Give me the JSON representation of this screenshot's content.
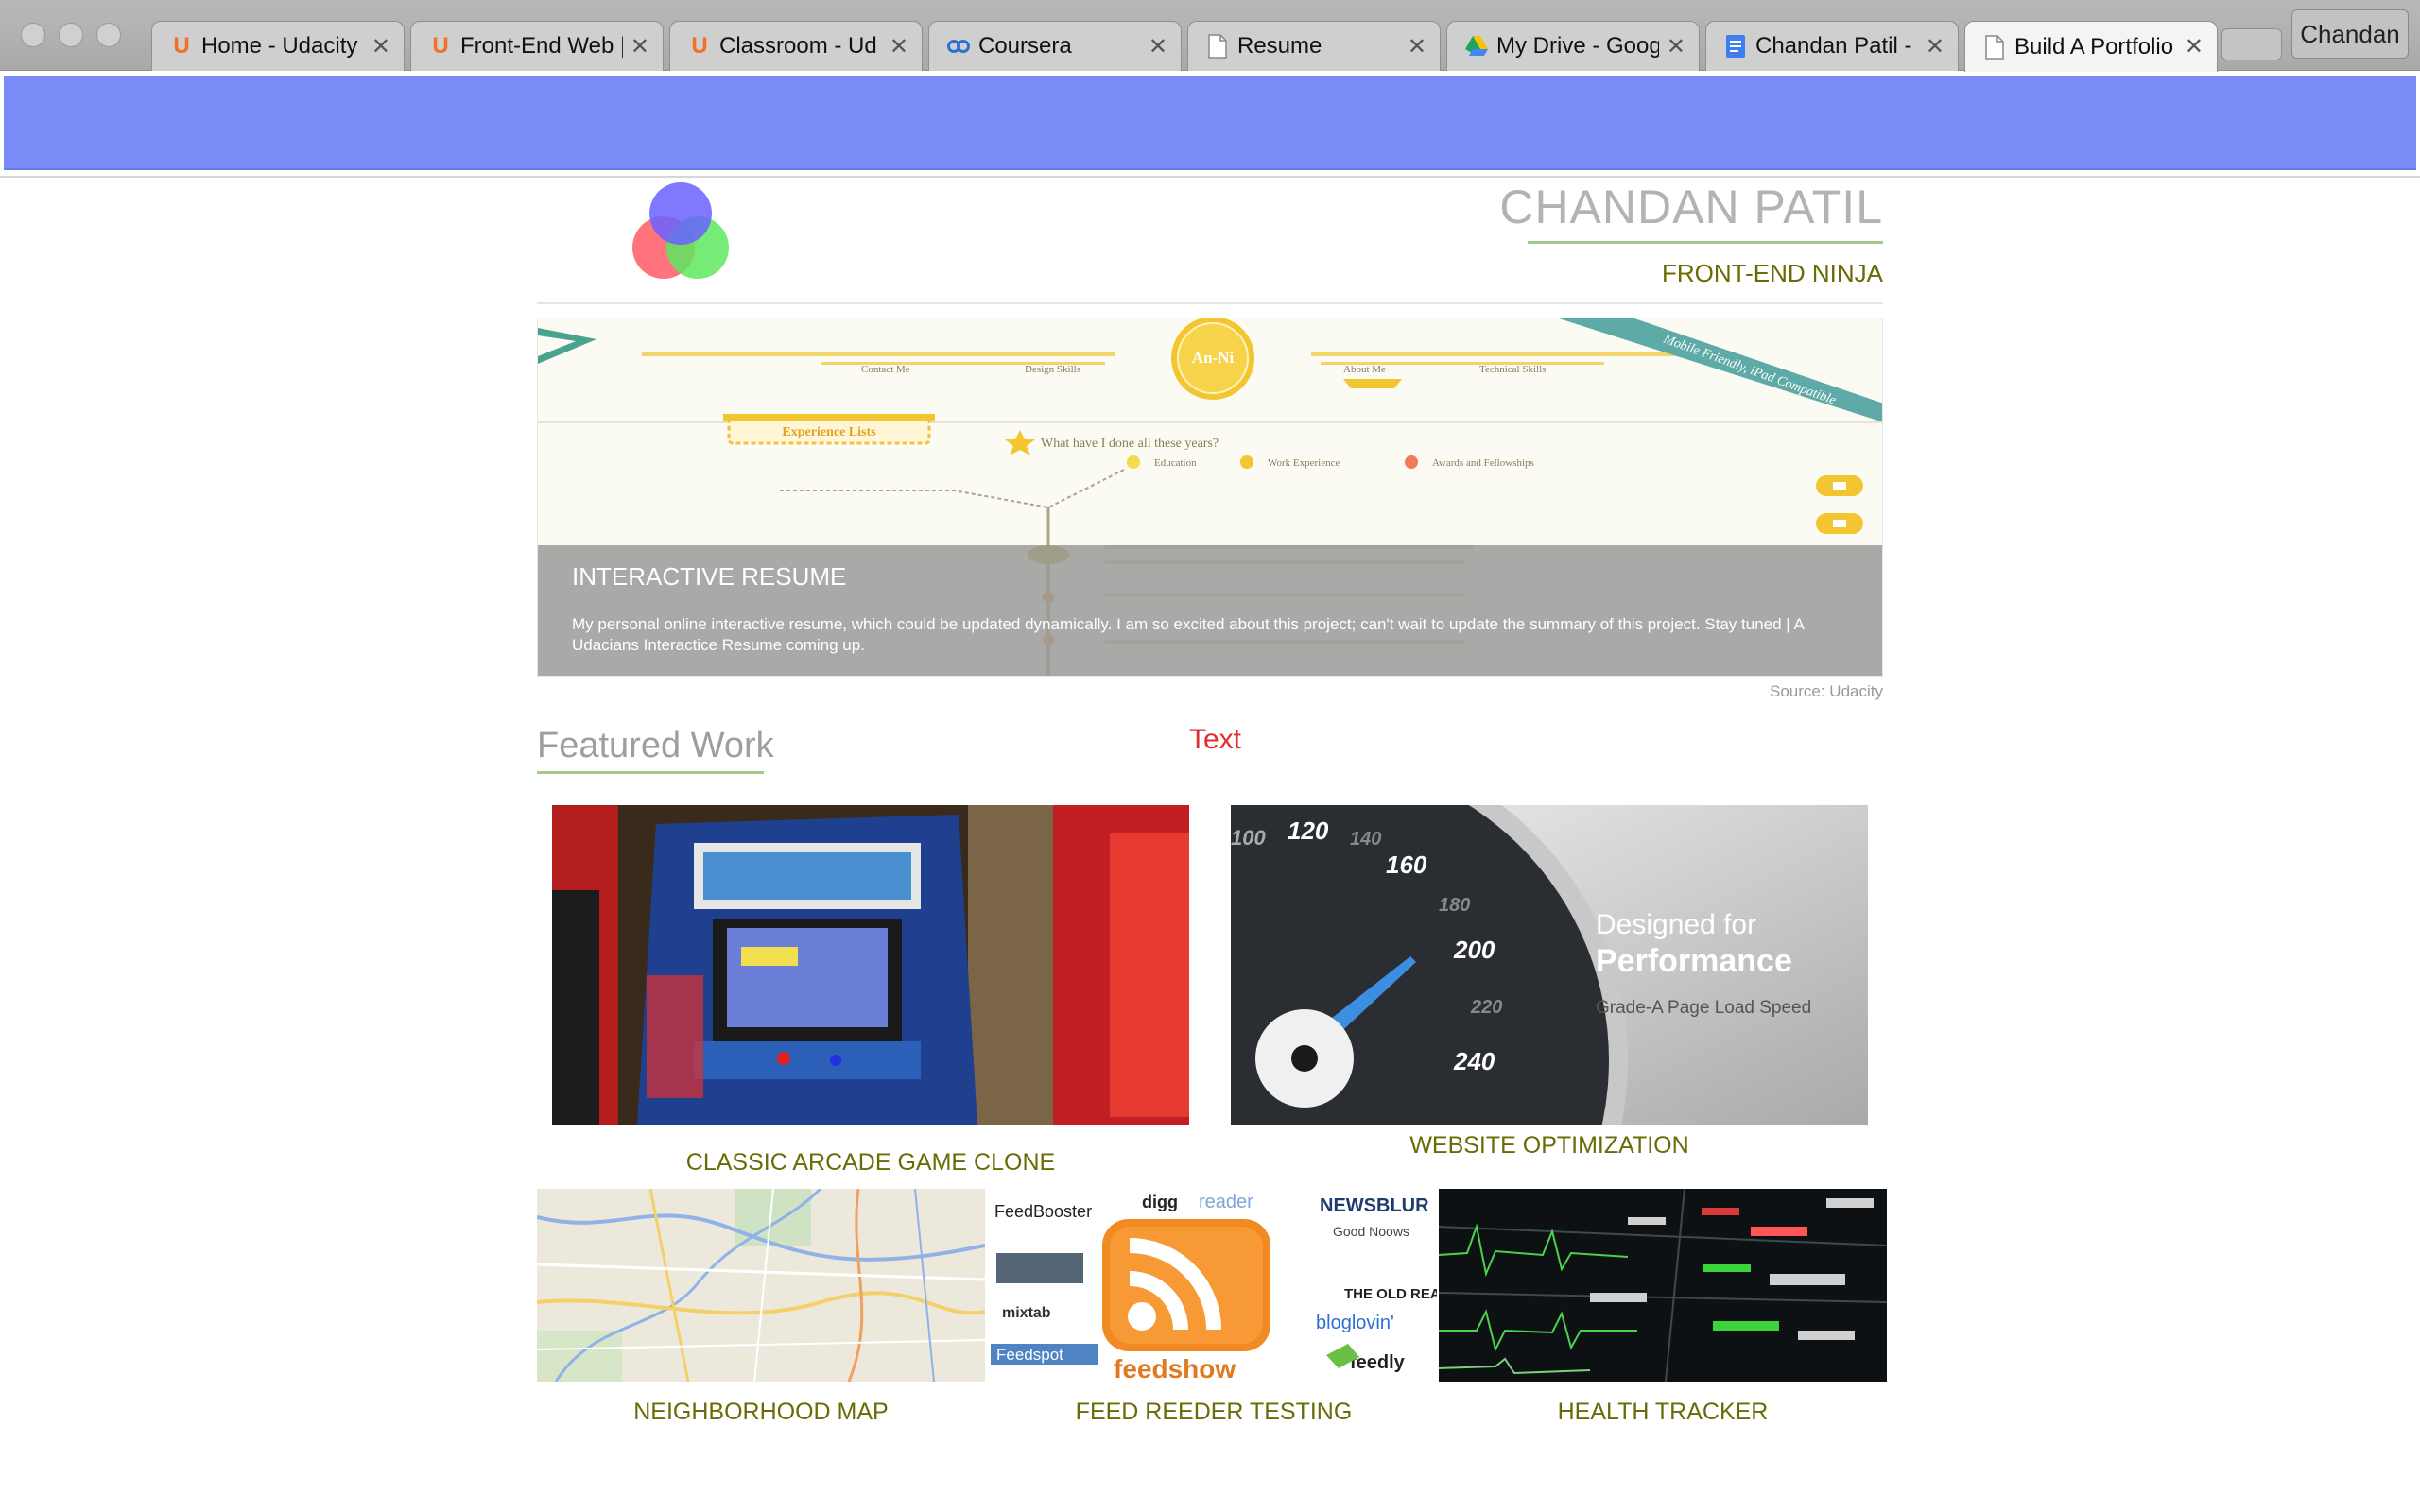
{
  "browser": {
    "tabs": [
      {
        "label": "Home - Udacity",
        "icon": "udacity-icon"
      },
      {
        "label": "Front-End Web |",
        "icon": "udacity-icon"
      },
      {
        "label": "Classroom - Ud",
        "icon": "udacity-icon"
      },
      {
        "label": "Coursera",
        "icon": "coursera-icon"
      },
      {
        "label": "Resume",
        "icon": "document-icon"
      },
      {
        "label": "My Drive - Goog",
        "icon": "google-drive-icon"
      },
      {
        "label": "Chandan Patil -",
        "icon": "google-docs-icon"
      },
      {
        "label": "Build A Portfolio",
        "icon": "document-icon"
      }
    ],
    "profile_name": "Chandan",
    "banner_color": "#7b8cf8"
  },
  "header": {
    "name": "CHANDAN PATIL",
    "tagline": "FRONT-END NINJA",
    "accent_color": "#6b6b06",
    "rule_color": "#a3c88b"
  },
  "hero": {
    "title": "INTERACTIVE RESUME",
    "description": "My personal online interactive resume, which could be updated dynamically. I am so excited about this project; can't wait to update the summary of this project. Stay tuned | A Udacians Interactice Resume coming up.",
    "source": "Source: Udacity",
    "image_text": {
      "badge": "An-Ni",
      "nav_contact": "Contact Me",
      "nav_design": "Design Skills",
      "nav_about": "About Me",
      "nav_technical": "Technical Skills",
      "ribbon": "Mobile Friendly, iPad Compatible",
      "experience": "Experience Lists",
      "question": "What have I done all these years?",
      "legend_education": "Education",
      "legend_work": "Work Experience",
      "legend_awards": "Awards and Fellowships"
    }
  },
  "featured": {
    "title": "Featured Work",
    "stray_text": "Text",
    "works": [
      {
        "title": "CLASSIC ARCADE GAME CLONE"
      },
      {
        "title": "WEBSITE OPTIMIZATION",
        "image_text": {
          "line1": "Designed for",
          "line2": "Performance",
          "line3": "Grade-A Page Load Speed",
          "speeds": [
            "100",
            "120",
            "140",
            "160",
            "180",
            "200",
            "220",
            "240"
          ]
        }
      },
      {
        "title": "NEIGHBORHOOD MAP"
      },
      {
        "title": "FEED REEDER TESTING",
        "image_text": {
          "brands": [
            "FeedBooster",
            "digg",
            "reader",
            "NEWSBLUR",
            "Good Noows",
            "mixtab",
            "Feedspot",
            "feedshow",
            "bloglovin'",
            "feedly",
            "THE OLD READER"
          ]
        }
      },
      {
        "title": "HEALTH TRACKER"
      }
    ]
  }
}
